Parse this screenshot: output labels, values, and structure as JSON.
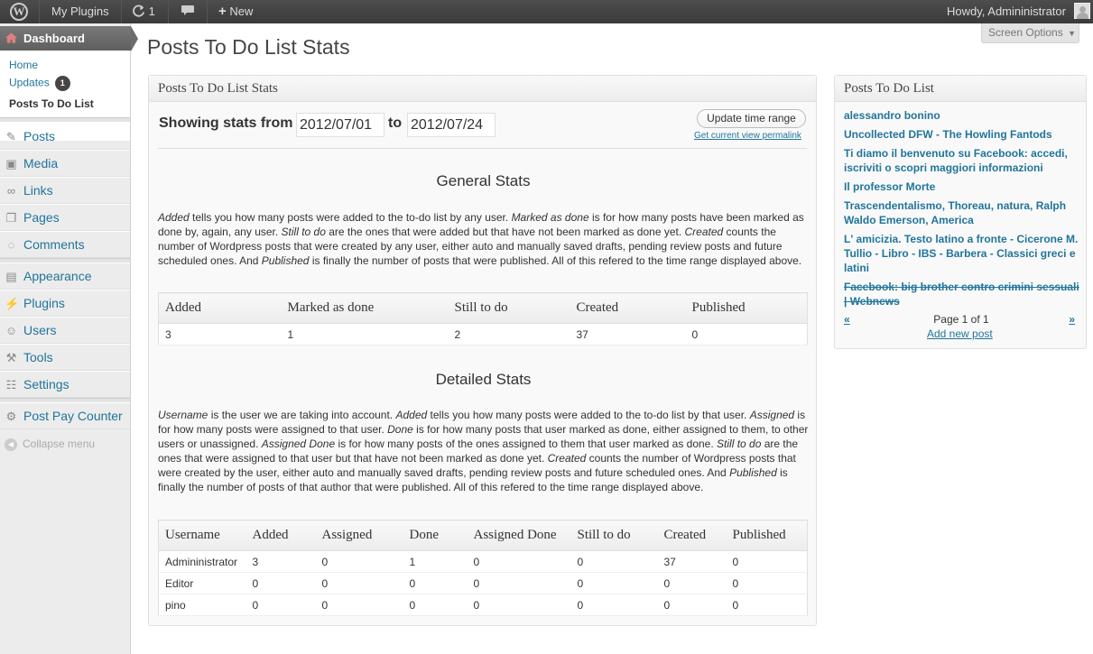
{
  "adminbar": {
    "site_name": "My Plugins",
    "updates_count": "1",
    "new_label": "New",
    "howdy": "Howdy, Admininistrator"
  },
  "sidebar": {
    "dashboard_label": "Dashboard",
    "submenu": [
      {
        "label": "Home"
      },
      {
        "label": "Updates",
        "badge": "1"
      },
      {
        "label": "Posts To Do List"
      }
    ],
    "items": [
      {
        "label": "Posts",
        "icon": "pin-icon"
      },
      {
        "label": "Media",
        "icon": "media-icon"
      },
      {
        "label": "Links",
        "icon": "links-icon"
      },
      {
        "label": "Pages",
        "icon": "pages-icon"
      },
      {
        "label": "Comments",
        "icon": "comments-icon"
      },
      {
        "label": "Appearance",
        "icon": "appearance-icon"
      },
      {
        "label": "Plugins",
        "icon": "plugins-icon"
      },
      {
        "label": "Users",
        "icon": "users-icon"
      },
      {
        "label": "Tools",
        "icon": "tools-icon"
      },
      {
        "label": "Settings",
        "icon": "settings-icon"
      },
      {
        "label": "Post Pay Counter",
        "icon": "gear-icon"
      }
    ],
    "collapse_label": "Collapse menu"
  },
  "page": {
    "title": "Posts To Do List Stats",
    "screen_options": "Screen Options"
  },
  "stats_box": {
    "title": "Posts To Do List Stats",
    "showing_label": "Showing stats from",
    "from_date": "2012/07/01",
    "to_label": "to",
    "to_date": "2012/07/24",
    "update_button": "Update time range",
    "permalink": "Get current view permalink",
    "general_heading": "General Stats",
    "general_text": {
      "t1": "Added",
      "t2": " tells you how many posts were added to the to-do list by any user. ",
      "t3": "Marked as done",
      "t4": " is for how many posts have been marked as done by, again, any user. ",
      "t5": "Still to do",
      "t6": " are the ones that were added but that have not been marked as done yet. ",
      "t7": "Created",
      "t8": " counts the number of Wordpress posts that were created by any user, either auto and manually saved drafts, pending review posts and future scheduled ones. And ",
      "t9": "Published",
      "t10": " is finally the number of posts that were published. All of this refered to the time range displayed above."
    },
    "general_table": {
      "headers": [
        "Added",
        "Marked as done",
        "Still to do",
        "Created",
        "Published"
      ],
      "row": [
        "3",
        "1",
        "2",
        "37",
        "0"
      ]
    },
    "detailed_heading": "Detailed Stats",
    "detailed_text": {
      "t1": "Username",
      "t2": " is the user we are taking into account. ",
      "t3": "Added",
      "t4": " tells you how many posts were added to the to-do list by that user. ",
      "t5": "Assigned",
      "t6": " is for how many posts were assigned to that user. ",
      "t7": "Done",
      "t8": " is for how many posts that user marked as done, either assigned to them, to other users or unassigned. ",
      "t9": "Assigned Done",
      "t10": " is for how many posts of the ones assigned to them that user marked as done. ",
      "t11": "Still to do",
      "t12": " are the ones that were assigned to that user but that have not been marked as done yet. ",
      "t13": "Created",
      "t14": " counts the number of Wordpress posts that were created by the user, either auto and manually saved drafts, pending review posts and future scheduled ones. And ",
      "t15": "Published",
      "t16": " is finally the number of posts of that author that were published. All of this refered to the time range displayed above."
    },
    "detailed_table": {
      "headers": [
        "Username",
        "Added",
        "Assigned",
        "Done",
        "Assigned Done",
        "Still to do",
        "Created",
        "Published"
      ],
      "rows": [
        [
          "Admininistrator",
          "3",
          "0",
          "1",
          "0",
          "0",
          "37",
          "0"
        ],
        [
          "Editor",
          "0",
          "0",
          "0",
          "0",
          "0",
          "0",
          "0"
        ],
        [
          "pino",
          "0",
          "0",
          "0",
          "0",
          "0",
          "0",
          "0"
        ]
      ]
    }
  },
  "todo_box": {
    "title": "Posts To Do List",
    "items": [
      {
        "label": "alessandro bonino"
      },
      {
        "label": "Uncollected DFW - The Howling Fantods"
      },
      {
        "label": "Ti diamo il benvenuto su Facebook: accedi, iscriviti o scopri maggiori informazioni"
      },
      {
        "label": "Il professor Morte"
      },
      {
        "label": "Trascendentalismo, Thoreau, natura, Ralph Waldo Emerson, America"
      },
      {
        "label": "L' amicizia. Testo latino a fronte - Cicerone M. Tullio - Libro - IBS - Barbera - Classici greci e latini"
      },
      {
        "label": "Facebook: big brother contro crimini sessuali | Webnews",
        "done": true
      }
    ],
    "prev": "«",
    "next": "»",
    "page_info": "Page 1 of 1",
    "add_new": "Add new post"
  }
}
